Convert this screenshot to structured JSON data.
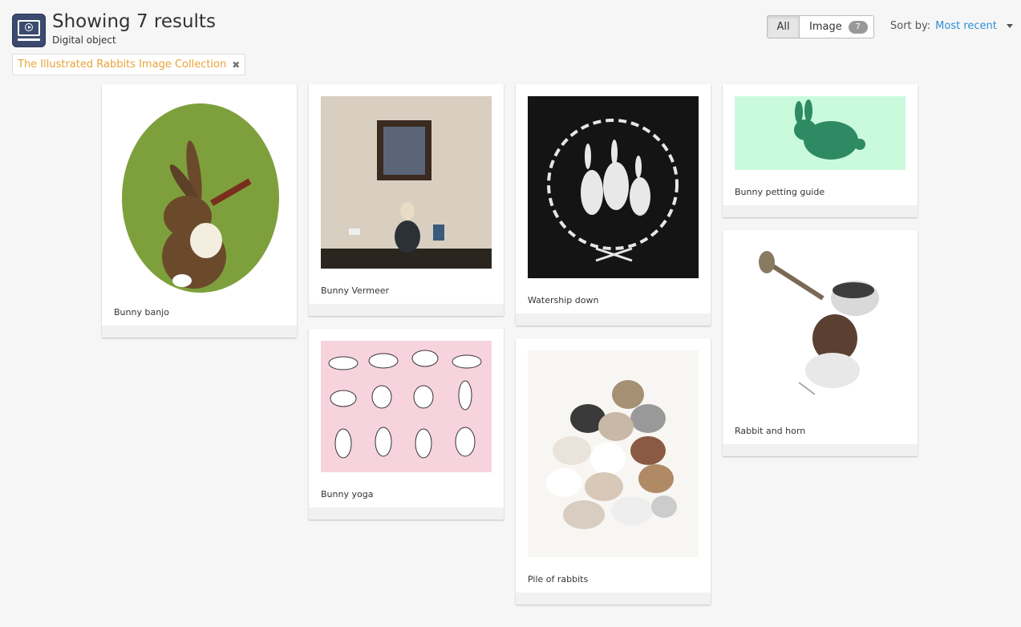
{
  "header": {
    "title": "Showing 7 results",
    "subtitle": "Digital object",
    "icon": "digital-object-icon"
  },
  "filter": {
    "label": "The Illustrated Rabbits Image Collection",
    "remove_icon": "✖"
  },
  "facets": {
    "all_label": "All",
    "image_label": "Image",
    "image_count": "7"
  },
  "sort": {
    "label": "Sort by:",
    "value": "Most recent"
  },
  "results": [
    {
      "caption": "Bunny banjo"
    },
    {
      "caption": "Bunny Vermeer"
    },
    {
      "caption": "Bunny yoga"
    },
    {
      "caption": "Watership down"
    },
    {
      "caption": "Pile of rabbits"
    },
    {
      "caption": "Bunny petting guide"
    },
    {
      "caption": "Rabbit and horn"
    }
  ],
  "colors": {
    "accent_link": "#2e8fd6",
    "filter_text": "#e8a33a",
    "icon_bg": "#3b4a6e"
  }
}
